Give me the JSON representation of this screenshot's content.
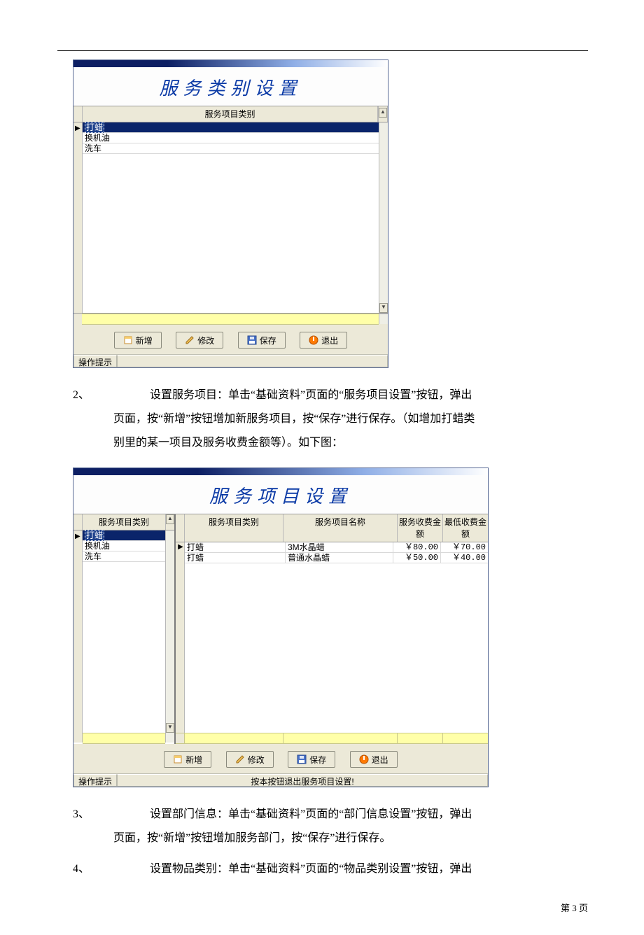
{
  "footer": {
    "page": "第 3 页"
  },
  "win1": {
    "title": "服务类别设置",
    "header": "服务项目类别",
    "rows": [
      "打蜡",
      "换机油",
      "洗车"
    ],
    "selected_index": 0,
    "buttons": {
      "add": "新增",
      "edit": "修改",
      "save": "保存",
      "exit": "退出"
    },
    "status_label": "操作提示"
  },
  "para2": {
    "num": "2、",
    "line1": "设置服务项目：单击“基础资料”页面的“服务项目设置”按钮，弹出",
    "line2": "页面，按“新增”按钮增加新服务项目，按“保存”进行保存。（如增加打蜡类",
    "line3": "别里的某一项目及服务收费金额等）。如下图："
  },
  "win2": {
    "title": "服务项目设置",
    "left": {
      "header": "服务项目类别",
      "rows": [
        "打蜡",
        "换机油",
        "洗车"
      ],
      "selected_index": 0
    },
    "right": {
      "headers": {
        "cat": "服务项目类别",
        "name": "服务项目名称",
        "price": "服务收费金额",
        "min": "最低收费金额"
      },
      "rows": [
        {
          "cat": "打蜡",
          "name": "3M水晶蜡",
          "price": "￥80.00",
          "min": "￥70.00",
          "marker": true
        },
        {
          "cat": "打蜡",
          "name": "普通水晶蜡",
          "price": "￥50.00",
          "min": "￥40.00"
        }
      ]
    },
    "buttons": {
      "add": "新增",
      "edit": "修改",
      "save": "保存",
      "exit": "退出"
    },
    "status_label": "操作提示",
    "status_text": "按本按钮退出服务项目设置!"
  },
  "para3": {
    "num": "3、",
    "line1": "设置部门信息：单击“基础资料”页面的“部门信息设置”按钮，弹出",
    "line2": "页面，按“新增”按钮增加服务部门，按“保存”进行保存。"
  },
  "para4": {
    "num": "4、",
    "line1": "设置物品类别：单击“基础资料”页面的“物品类别设置”按钮，弹出"
  },
  "icons": {
    "add": "new-file-icon",
    "edit": "pencil-icon",
    "save": "diskette-icon",
    "exit": "power-icon"
  }
}
